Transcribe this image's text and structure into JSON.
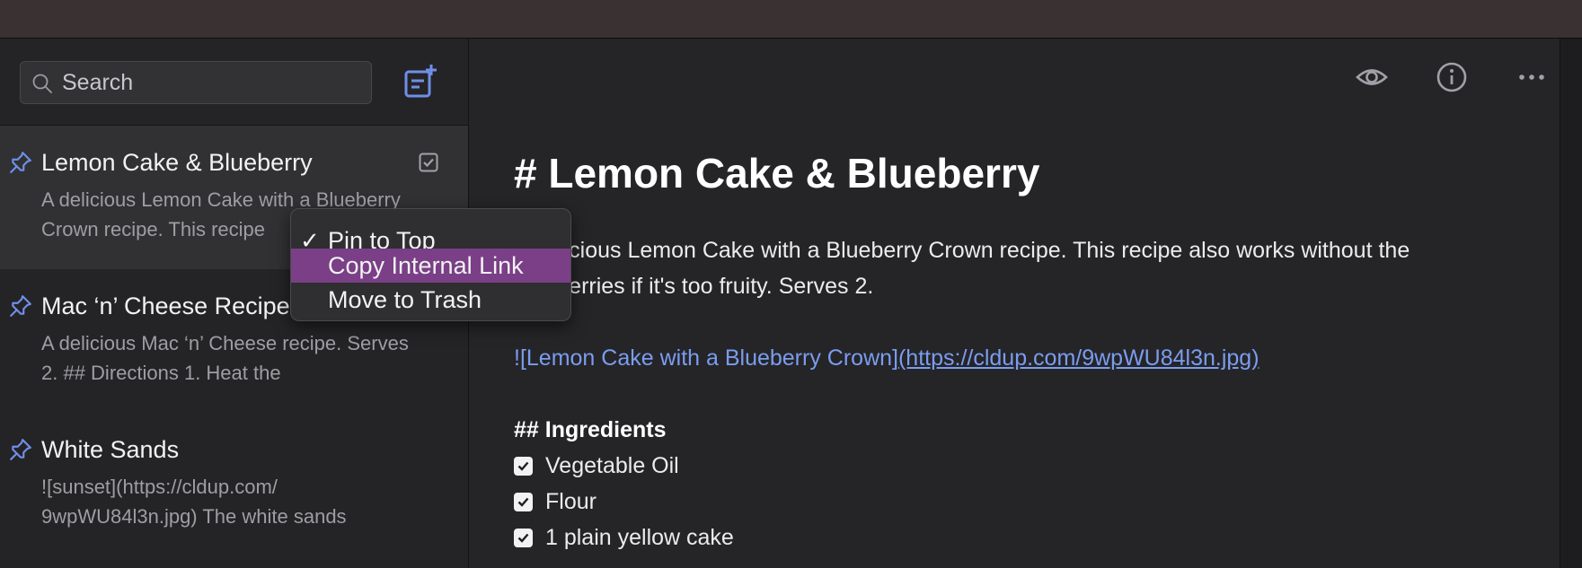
{
  "search": {
    "placeholder": "Search"
  },
  "notes": [
    {
      "title": "Lemon Cake & Blueberry",
      "snippet": "A delicious Lemon Cake with a Blueberry Crown recipe. This recipe",
      "pinned": true,
      "selected": true
    },
    {
      "title": "Mac ‘n’ Cheese Recipe",
      "snippet": "A delicious Mac ‘n’ Cheese recipe. Serves 2. ## Directions 1. Heat the",
      "pinned": true,
      "selected": false
    },
    {
      "title": "White Sands",
      "snippet": "![sunset](https://cldup.com/ 9wpWU84l3n.jpg) The white sands",
      "pinned": true,
      "selected": false
    }
  ],
  "context_menu": {
    "items": [
      {
        "label": "Pin to Top",
        "checked": true,
        "highlighted": false
      },
      {
        "label": "Copy Internal Link",
        "checked": false,
        "highlighted": true
      },
      {
        "label": "Move to Trash",
        "checked": false,
        "highlighted": false
      }
    ]
  },
  "toolbar": {
    "icons": [
      "preview-eye-icon",
      "info-icon",
      "more-ellipsis-icon"
    ]
  },
  "editor": {
    "heading": "# Lemon Cake & Blueberry",
    "paragraph": "A delicious Lemon Cake with a Blueberry Crown recipe. This recipe also works without the blueberries if it's too fruity. Serves 2.",
    "image_alt": "![Lemon Cake with a Blueberry Crown]",
    "image_url": "(https://cldup.com/9wpWU84l3n.jpg)",
    "ingredients_heading": "## Ingredients",
    "ingredients": [
      "Vegetable Oil",
      "Flour",
      "1 plain yellow cake"
    ]
  },
  "colors": {
    "accent": "#6f8fe8",
    "highlight": "#7a3f86",
    "link": "#7b9cf0"
  }
}
